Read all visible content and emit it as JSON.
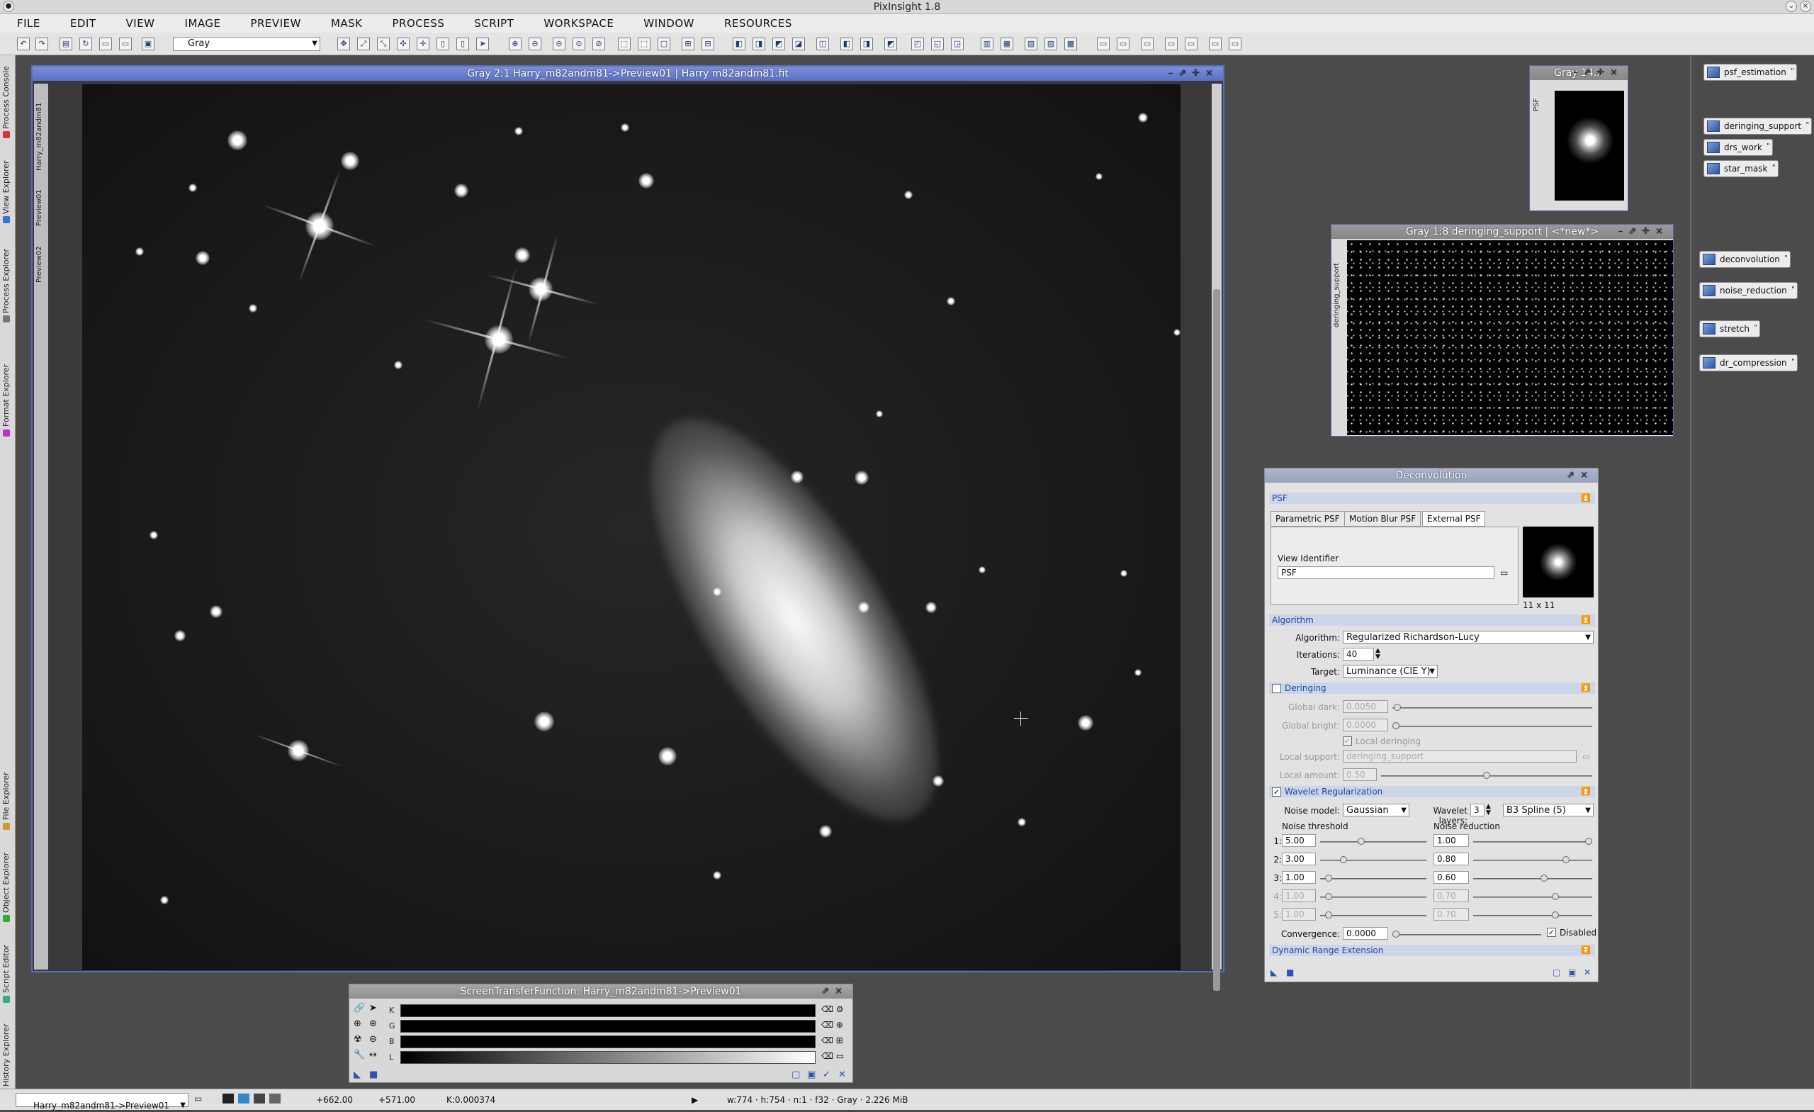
{
  "app": {
    "title": "PixInsight 1.8"
  },
  "menu": [
    "FILE",
    "EDIT",
    "VIEW",
    "IMAGE",
    "PREVIEW",
    "MASK",
    "PROCESS",
    "SCRIPT",
    "WORKSPACE",
    "WINDOW",
    "RESOURCES"
  ],
  "toolbar": {
    "channel_combo": "Gray"
  },
  "left_tabs": [
    "Process Console",
    "View Explorer",
    "Process Explorer",
    "Format Explorer",
    "File Explorer",
    "Object Explorer",
    "Script Editor",
    "History Explorer"
  ],
  "image_window": {
    "title": "Gray 2:1 Harry_m82andm81->Preview01 | Harry m82andm81.fit",
    "tabs": [
      "Harry_m82andm81",
      "Preview01",
      "Preview02"
    ]
  },
  "psf_window": {
    "title": "Gray 14...",
    "tab": "PSF"
  },
  "deringing_window": {
    "title": "Gray 1:8 deringing_support | <*new*>",
    "tab": "deringing_support"
  },
  "process_icons": [
    "psf_estimation",
    "deringing_support",
    "drs_work",
    "star_mask",
    "deconvolution",
    "noise_reduction",
    "stretch",
    "dr_compression"
  ],
  "deconvolution": {
    "title": "Deconvolution",
    "psf_section": "PSF",
    "psf_tabs": [
      "Parametric PSF",
      "Motion Blur PSF",
      "External PSF"
    ],
    "view_identifier_label": "View Identifier",
    "view_identifier": "PSF",
    "psf_size": "11 x 11",
    "algorithm_section": "Algorithm",
    "algorithm_label": "Algorithm:",
    "algorithm": "Regularized Richardson-Lucy",
    "iterations_label": "Iterations:",
    "iterations": "40",
    "target_label": "Target:",
    "target": "Luminance (CIE Y)",
    "deringing_section": "Deringing",
    "global_dark_label": "Global dark:",
    "global_dark": "0.0050",
    "global_bright_label": "Global bright:",
    "global_bright": "0.0000",
    "local_deringing_label": "Local deringing",
    "local_support_label": "Local support:",
    "local_support": "deringing_support",
    "local_amount_label": "Local amount:",
    "local_amount": "0.50",
    "wavelet_section": "Wavelet Regularization",
    "noise_model_label": "Noise model:",
    "noise_model": "Gaussian",
    "wavelet_layers_label": "Wavelet layers:",
    "wavelet_layers": "3",
    "wavelet_type": "B3 Spline (5)",
    "noise_threshold_label": "Noise threshold",
    "noise_reduction_label": "Noise reduction",
    "layers": [
      {
        "n": "1:",
        "threshold": "5.00",
        "reduction": "1.00",
        "t_pos": 0.38,
        "r_pos": 1.0,
        "enabled": true
      },
      {
        "n": "2:",
        "threshold": "3.00",
        "reduction": "0.80",
        "t_pos": 0.2,
        "r_pos": 0.8,
        "enabled": true
      },
      {
        "n": "3:",
        "threshold": "1.00",
        "reduction": "0.60",
        "t_pos": 0.05,
        "r_pos": 0.6,
        "enabled": true
      },
      {
        "n": "4:",
        "threshold": "1.00",
        "reduction": "0.70",
        "t_pos": 0.05,
        "r_pos": 0.7,
        "enabled": false
      },
      {
        "n": "5:",
        "threshold": "1.00",
        "reduction": "0.70",
        "t_pos": 0.05,
        "r_pos": 0.7,
        "enabled": false
      }
    ],
    "convergence_label": "Convergence:",
    "convergence": "0.0000",
    "disabled_label": "Disabled",
    "dre_section": "Dynamic Range Extension"
  },
  "stf": {
    "title": "ScreenTransferFunction: Harry_m82andm81->Preview01",
    "channels": [
      "K",
      "G",
      "B",
      "L"
    ]
  },
  "status": {
    "view": "Harry_m82andm81->Preview01",
    "x": "+662.00",
    "y": "+571.00",
    "k": "K:0.000374",
    "info": "w:774 · h:754 · n:1 · f32 · Gray · 2.226 MiB"
  }
}
